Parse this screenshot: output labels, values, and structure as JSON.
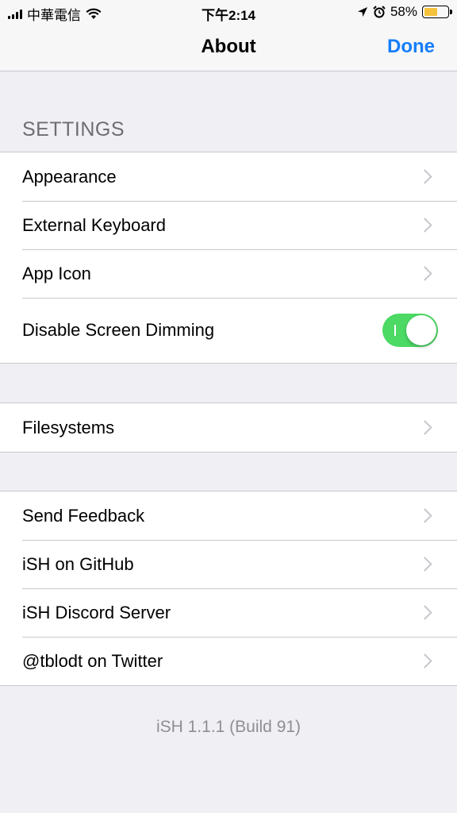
{
  "status_bar": {
    "carrier": "中華電信",
    "time": "下午2:14",
    "battery": "58%",
    "battery_level": 0.58,
    "icons": [
      "signal-icon",
      "wifi-icon",
      "location-icon",
      "alarm-icon",
      "battery-icon"
    ]
  },
  "nav": {
    "title": "About",
    "done_label": "Done"
  },
  "settings": {
    "header": "SETTINGS",
    "items": [
      {
        "label": "Appearance"
      },
      {
        "label": "External Keyboard"
      },
      {
        "label": "App Icon"
      },
      {
        "label": "Disable Screen Dimming",
        "toggle_on": true
      }
    ]
  },
  "storage": {
    "items": [
      {
        "label": "Filesystems"
      }
    ]
  },
  "links": {
    "items": [
      {
        "label": "Send Feedback"
      },
      {
        "label": "iSH on GitHub"
      },
      {
        "label": "iSH Discord Server"
      },
      {
        "label": "@tblodt on Twitter"
      }
    ]
  },
  "footer": {
    "version": "iSH 1.1.1 (Build 91)"
  },
  "colors": {
    "accent": "#157efb",
    "toggle_on": "#4cd964",
    "background": "#efeff4",
    "battery": "#f6c23b"
  }
}
